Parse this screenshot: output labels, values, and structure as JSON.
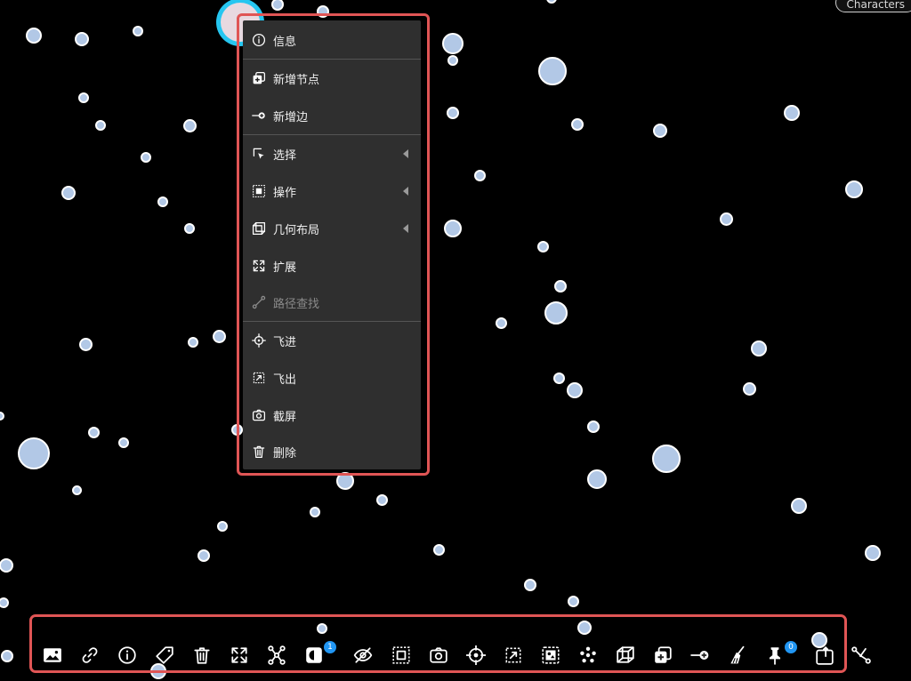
{
  "top_right_chip": "Characters",
  "context_menu": {
    "items": [
      {
        "name": "info",
        "label": "信息",
        "icon": "info-icon",
        "submenu": false,
        "disabled": false
      },
      {
        "name": "add-node",
        "label": "新增节点",
        "icon": "add-node-icon",
        "submenu": false,
        "disabled": false
      },
      {
        "name": "add-edge",
        "label": "新增边",
        "icon": "add-edge-icon",
        "submenu": false,
        "disabled": false
      },
      {
        "name": "select",
        "label": "选择",
        "icon": "select-icon",
        "submenu": true,
        "disabled": false
      },
      {
        "name": "operate",
        "label": "操作",
        "icon": "operate-icon",
        "submenu": true,
        "disabled": false
      },
      {
        "name": "geometric-layout",
        "label": "几何布局",
        "icon": "layout-icon",
        "submenu": true,
        "disabled": false
      },
      {
        "name": "expand",
        "label": "扩展",
        "icon": "expand-icon",
        "submenu": false,
        "disabled": false
      },
      {
        "name": "path-find",
        "label": "路径查找",
        "icon": "path-icon",
        "submenu": false,
        "disabled": true
      },
      {
        "name": "fly-in",
        "label": "飞进",
        "icon": "fly-in-icon",
        "submenu": false,
        "disabled": false
      },
      {
        "name": "fly-out",
        "label": "飞出",
        "icon": "fly-out-icon",
        "submenu": false,
        "disabled": false
      },
      {
        "name": "screenshot",
        "label": "截屏",
        "icon": "camera-icon",
        "submenu": false,
        "disabled": false
      },
      {
        "name": "delete",
        "label": "删除",
        "icon": "trash-icon",
        "submenu": false,
        "disabled": false
      }
    ]
  },
  "toolbar": {
    "items": [
      {
        "name": "image",
        "icon": "image-icon"
      },
      {
        "name": "link",
        "icon": "link-icon"
      },
      {
        "name": "info",
        "icon": "info-icon"
      },
      {
        "name": "tag",
        "icon": "tag-icon"
      },
      {
        "name": "delete",
        "icon": "trash-icon"
      },
      {
        "name": "expand",
        "icon": "expand-icon"
      },
      {
        "name": "graph",
        "icon": "graph-icon"
      },
      {
        "name": "contrast",
        "icon": "contrast-icon",
        "badge": "1"
      },
      {
        "name": "hide",
        "icon": "eye-off-icon"
      },
      {
        "name": "select-region",
        "icon": "select-region-icon"
      },
      {
        "name": "screenshot",
        "icon": "camera-icon"
      },
      {
        "name": "target",
        "icon": "target-icon"
      },
      {
        "name": "fly-out",
        "icon": "fly-out-icon"
      },
      {
        "name": "invert",
        "icon": "invert-icon"
      },
      {
        "name": "cluster",
        "icon": "cluster-icon"
      },
      {
        "name": "cube",
        "icon": "cube-icon"
      },
      {
        "name": "add-node",
        "icon": "add-node-icon"
      },
      {
        "name": "add-edge",
        "icon": "add-edge-icon"
      },
      {
        "name": "clean",
        "icon": "broom-icon"
      },
      {
        "name": "pin",
        "icon": "pin-icon",
        "badge": "0"
      },
      {
        "name": "pointer",
        "icon": "hand-icon"
      },
      {
        "name": "shortest-path",
        "icon": "path-icon"
      }
    ]
  },
  "colors": {
    "node_fill": "#b2c8e6",
    "highlight": "#e05555",
    "badge": "#2196f3",
    "selected_node": "#26c6f0"
  }
}
